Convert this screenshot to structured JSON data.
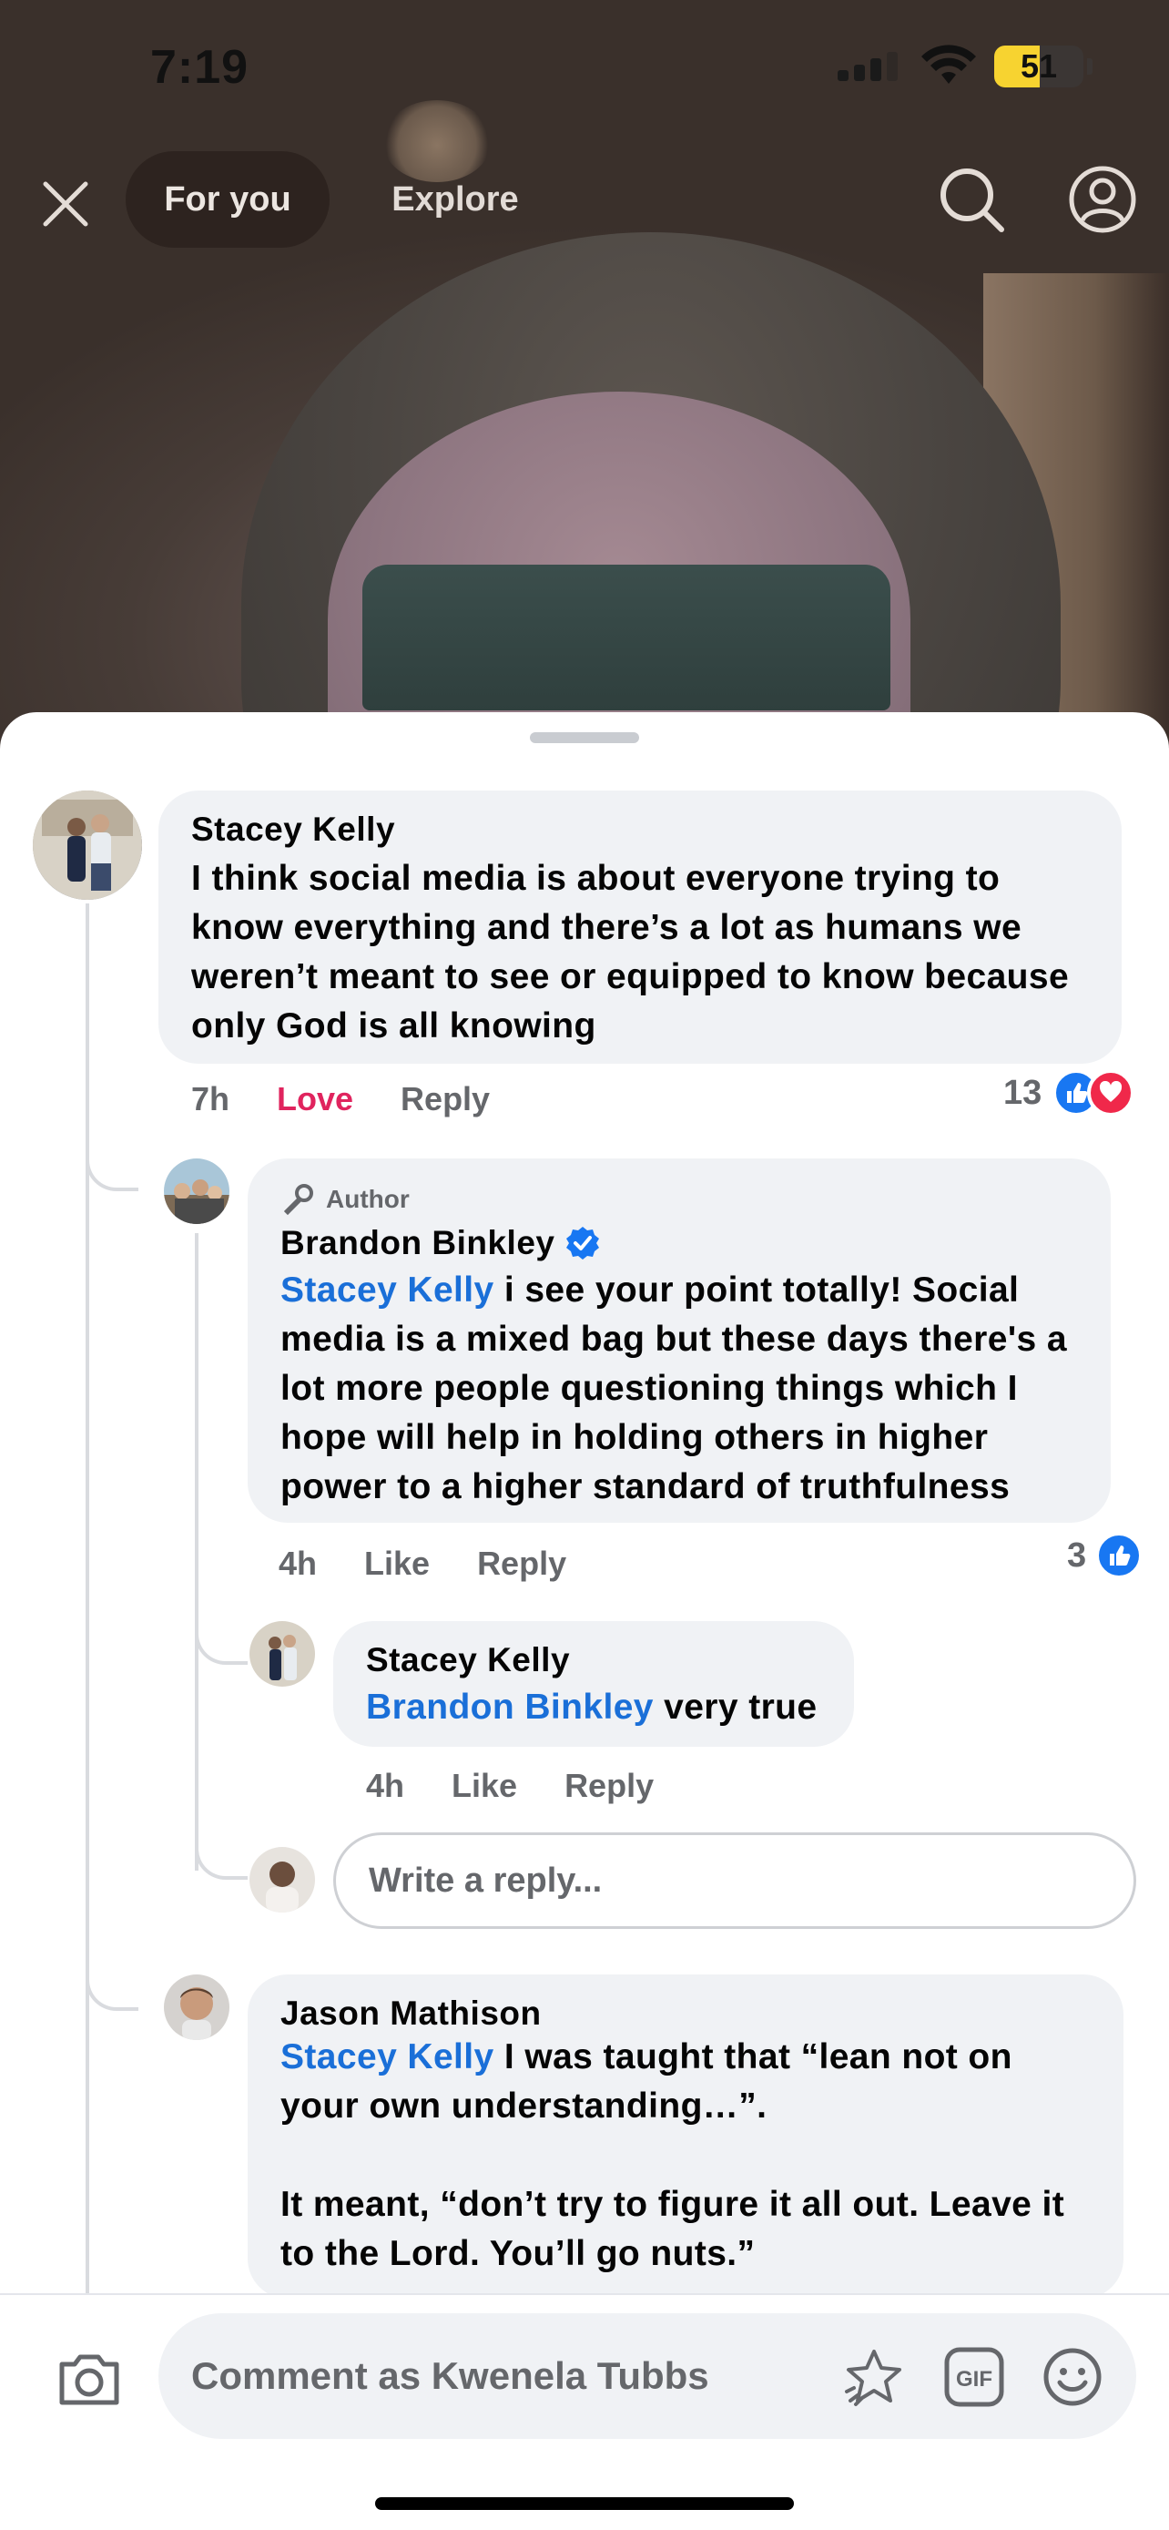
{
  "status_bar": {
    "time": "7:19",
    "battery": "51",
    "battery_level": 0.51
  },
  "nav": {
    "tabs": [
      {
        "label": "For you"
      },
      {
        "label": "Explore"
      }
    ]
  },
  "comments": [
    {
      "name": "Stacey Kelly",
      "lines": [
        "I think social media is about everyone trying to",
        "know everything and there’s a lot as humans we",
        "weren’t meant to see or equipped to know because",
        "only God is all knowing"
      ],
      "time": "7h",
      "reaction_label": "Love",
      "reply_label": "Reply",
      "reaction_count": "13"
    },
    {
      "badge": "Author",
      "name": "Brandon Binkley",
      "mention": "Stacey Kelly",
      "first_line_rest": " i see your point totally! Social",
      "lines": [
        "media is a mixed bag but these days there's a",
        "lot more people questioning things which I",
        "hope will help in holding others in higher",
        "power to a higher standard of truthfulness"
      ],
      "time": "4h",
      "like_label": "Like",
      "reply_label": "Reply",
      "reaction_count": "3"
    },
    {
      "name": "Stacey Kelly",
      "mention": "Brandon Binkley",
      "text_rest": " very true",
      "time": "4h",
      "like_label": "Like",
      "reply_label": "Reply"
    },
    {
      "name": "Jason Mathison",
      "mention": "Stacey Kelly",
      "first_line_rest": " I was taught that “lean not on",
      "line2": "your own understanding…”.",
      "line3": "It meant, “don’t try to figure it all out.  Leave it",
      "line4": "to the Lord.  You’ll go nuts.”"
    }
  ],
  "reply_input": {
    "placeholder": "Write a reply..."
  },
  "composer": {
    "placeholder": "Comment as Kwenela Tubbs"
  },
  "colors": {
    "accent": "#1877f2",
    "mention": "#1a6fd8",
    "love": "#e0245e"
  },
  "icons": [
    "close-icon",
    "search-icon",
    "profile-icon",
    "verified-badge-icon",
    "microphone-icon",
    "like-reaction-icon",
    "love-reaction-icon",
    "camera-icon",
    "sticker-icon",
    "gif-icon",
    "emoji-icon"
  ]
}
